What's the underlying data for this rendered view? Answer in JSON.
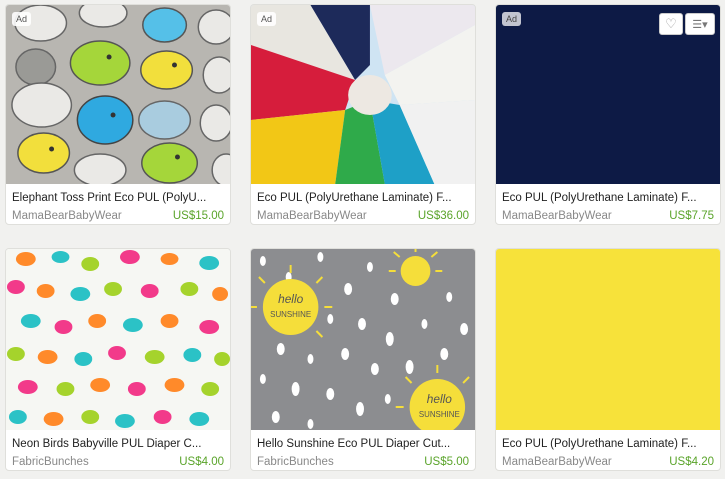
{
  "listings": [
    {
      "ad": "Ad",
      "title": "Elephant Toss Print Eco PUL (PolyU...",
      "shop": "MamaBearBabyWear",
      "price": "US$15.00"
    },
    {
      "ad": "Ad",
      "title": "Eco PUL (PolyUrethane Laminate) F...",
      "shop": "MamaBearBabyWear",
      "price": "US$36.00"
    },
    {
      "ad": "Ad",
      "title": "Eco PUL (PolyUrethane Laminate) F...",
      "shop": "MamaBearBabyWear",
      "price": "US$7.75",
      "favorite_icon": "heart-icon",
      "menu_icon": "hamburger-menu-icon"
    },
    {
      "title": "Neon Birds Babyville PUL Diaper C...",
      "shop": "FabricBunches",
      "price": "US$4.00"
    },
    {
      "title": "Hello Sunshine Eco PUL Diaper Cut...",
      "shop": "FabricBunches",
      "price": "US$5.00",
      "image_text": [
        "hello",
        "SUNSHINE",
        "hello",
        "SUNSHINE"
      ]
    },
    {
      "title": "Eco PUL (PolyUrethane Laminate) F...",
      "shop": "MamaBearBabyWear",
      "price": "US$4.20"
    }
  ],
  "colors": {
    "price": "#5aa42a",
    "shop": "#888888",
    "navy": "#0d1a45",
    "yellow": "#f7e23a",
    "gray": "#8c8d90"
  }
}
